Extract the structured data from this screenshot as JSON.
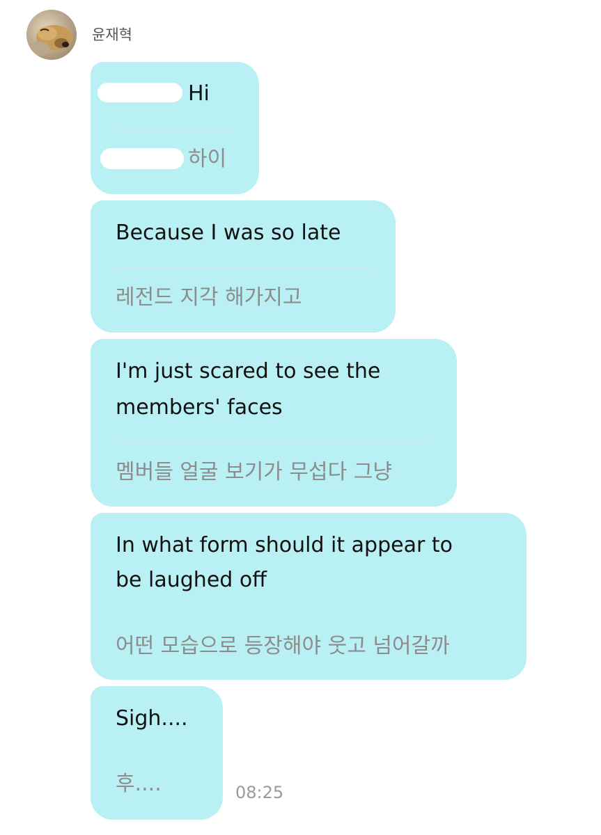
{
  "chat": {
    "sender_name": "윤재혁",
    "avatar_icon": "dog-photo-avatar",
    "bubble_color": "#b9f0f3",
    "messages": [
      {
        "text": "Hi",
        "translation": "하이"
      },
      {
        "text": "Because I was so late",
        "translation": "레전드 지각 해가지고"
      },
      {
        "text_line1": "I'm just scared to see the",
        "text_line2": "members' faces",
        "translation": "멤버들 얼굴 보기가 무섭다 그냥"
      },
      {
        "text_line1": "In what form should it appear to",
        "text_line2": "be laughed off",
        "translation": "어떤 모습으로 등장해야 웃고 넘어갈까"
      },
      {
        "text": "Sigh....",
        "translation": "후...."
      }
    ],
    "timestamp": "08:25"
  }
}
